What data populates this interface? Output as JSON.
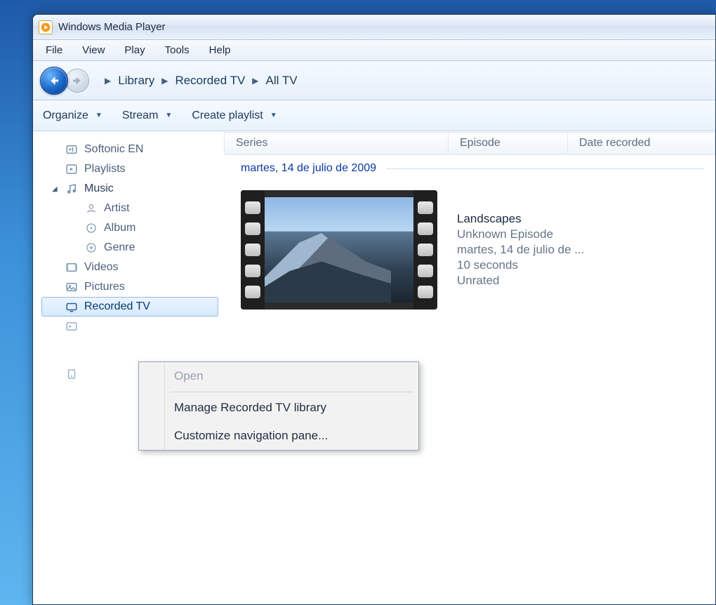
{
  "window": {
    "title": "Windows Media Player"
  },
  "menubar": [
    "File",
    "View",
    "Play",
    "Tools",
    "Help"
  ],
  "breadcrumb": [
    "Library",
    "Recorded TV",
    "All TV"
  ],
  "toolbar": {
    "organize": "Organize",
    "stream": "Stream",
    "create_playlist": "Create playlist"
  },
  "columns": {
    "series": "Series",
    "episode": "Episode",
    "date_recorded": "Date recorded"
  },
  "date_group": "martes, 14 de julio de 2009",
  "item": {
    "title": "Landscapes",
    "episode": "Unknown Episode",
    "date": "martes, 14 de julio de ...",
    "duration": "10 seconds",
    "rating": "Unrated"
  },
  "sidebar": {
    "softonic": "Softonic EN",
    "playlists": "Playlists",
    "music": "Music",
    "artist": "Artist",
    "album": "Album",
    "genre": "Genre",
    "videos": "Videos",
    "pictures": "Pictures",
    "recorded_tv": "Recorded TV"
  },
  "context_menu": {
    "open": "Open",
    "manage": "Manage Recorded TV library",
    "customize": "Customize navigation pane..."
  }
}
